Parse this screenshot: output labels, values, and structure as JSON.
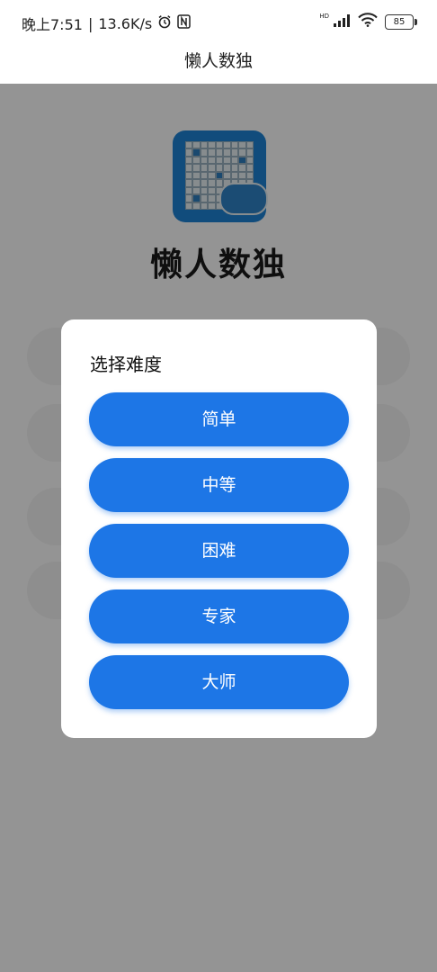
{
  "status_bar": {
    "time": "晚上7:51",
    "separator": "|",
    "net_speed": "13.6K/s",
    "alarm_icon": "alarm-icon",
    "nfc_icon": "nfc-icon",
    "hd_label": "HD",
    "battery_level": "85"
  },
  "app_bar": {
    "title": "懒人数独"
  },
  "background": {
    "app_name": "懒人数独"
  },
  "dialog": {
    "title": "选择难度",
    "options": [
      {
        "label": "简单"
      },
      {
        "label": "中等"
      },
      {
        "label": "困难"
      },
      {
        "label": "专家"
      },
      {
        "label": "大师"
      }
    ]
  },
  "colors": {
    "primary_button": "#1d76e6",
    "overlay": "rgba(0,0,0,0.42)",
    "logo_bg": "#1e84d6"
  }
}
